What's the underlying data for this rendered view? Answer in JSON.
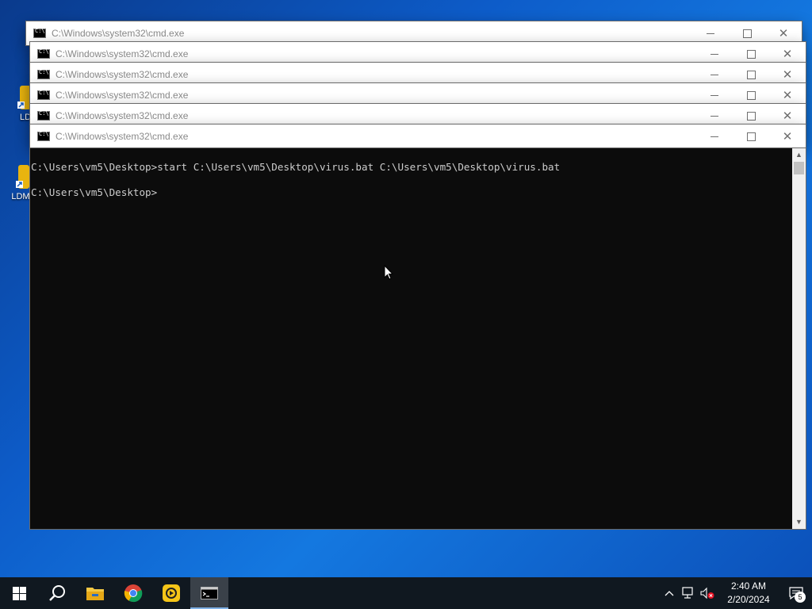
{
  "windows": [
    {
      "title": "C:\\Windows\\system32\\cmd.exe"
    },
    {
      "title": "C:\\Windows\\system32\\cmd.exe"
    },
    {
      "title": "C:\\Windows\\system32\\cmd.exe"
    },
    {
      "title": "C:\\Windows\\system32\\cmd.exe"
    },
    {
      "title": "C:\\Windows\\system32\\cmd.exe"
    },
    {
      "title": "C:\\Windows\\system32\\cmd.exe"
    }
  ],
  "console": {
    "lines": [
      "C:\\Users\\vm5\\Desktop>start C:\\Users\\vm5\\Desktop\\virus.bat C:\\Users\\vm5\\Desktop\\virus.bat",
      "",
      "C:\\Users\\vm5\\Desktop>"
    ]
  },
  "desktop_icons": [
    {
      "label": "LD",
      "icon": "ldplayer-shortcut-icon"
    },
    {
      "label": "LDM",
      "icon": "ldmultiplayer-shortcut-icon"
    }
  ],
  "taskbar": {
    "apps": [
      "start-icon",
      "search-icon",
      "file-explorer-icon",
      "chrome-icon",
      "ldplayer-icon",
      "cmd-icon"
    ],
    "clock_time": "2:40 AM",
    "clock_date": "2/20/2024",
    "notification_count": "5"
  },
  "colors": {
    "console_bg": "#0c0c0c",
    "console_fg": "#cccccc",
    "taskbar_bg": "#101820"
  }
}
